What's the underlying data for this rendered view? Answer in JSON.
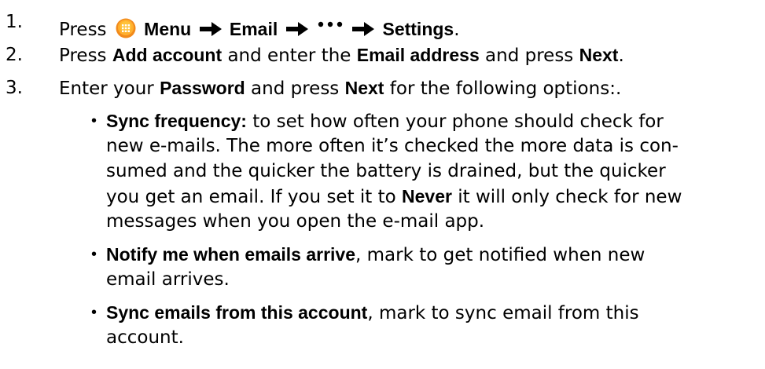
{
  "steps": [
    {
      "number": "1.",
      "press": "Press",
      "menu": "Menu",
      "email": "Email",
      "settings": "Settings",
      "end": "."
    },
    {
      "number": "2.",
      "p1": "Press",
      "b1": "Add account",
      "p2": " and enter the",
      "b2": "Email address",
      "p3": " and press",
      "b3": "Next",
      "p4": "."
    },
    {
      "number": "3.",
      "p1": "Enter your",
      "b1": "Password",
      "p2": " and press",
      "b2": "Next",
      "p3": " for the following options:."
    }
  ],
  "options": [
    {
      "bullet": "•",
      "title": "Sync frequency:",
      "line1_rest": " to set how often your phone should check for",
      "line2": "new e-mails. The more often it’s checked the more data is con-",
      "line3": "sumed and the quicker the battery is drained, but the quicker",
      "line4_a": "you get an email. If you set it to",
      "line4_b": "Never",
      "line4_c": " it will only check for new",
      "line5": "messages when you open the e-mail app."
    },
    {
      "bullet": "•",
      "title": "Notify me when emails arrive",
      "line1_rest": ", mark to get notified when new",
      "line2": "email arrives."
    },
    {
      "bullet": "•",
      "title": "Sync emails from this account",
      "line1_rest": ", mark to sync email from this",
      "line2": "account."
    }
  ],
  "icons": {
    "menu": "menu-grid-icon",
    "arrow": "right-arrow-icon",
    "more": "more-dots-icon"
  },
  "colors": {
    "menu_icon_outer": "#f28a1b",
    "menu_icon_inner": "#ffc23a",
    "text": "#000000"
  }
}
